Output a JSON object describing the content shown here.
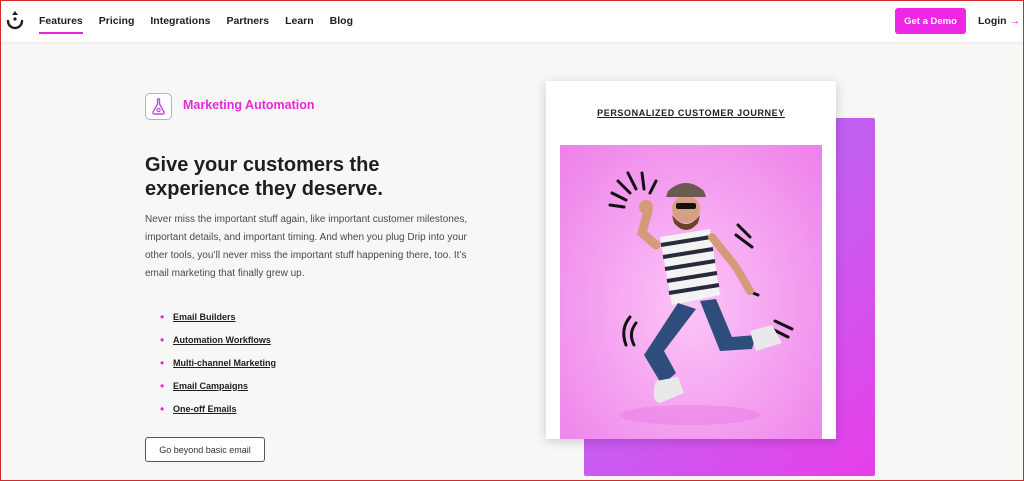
{
  "nav": {
    "items": [
      {
        "label": "Features",
        "active": true
      },
      {
        "label": "Pricing",
        "active": false
      },
      {
        "label": "Integrations",
        "active": false
      },
      {
        "label": "Partners",
        "active": false
      },
      {
        "label": "Learn",
        "active": false
      },
      {
        "label": "Blog",
        "active": false
      }
    ],
    "demo_label": "Get a Demo",
    "login_label": "Login",
    "login_arrow": "→"
  },
  "hero": {
    "badge_label": "Marketing Automation",
    "headline": "Give your customers the experience they deserve.",
    "description": "Never miss the important stuff again, like important customer milestones, important details, and important timing. And when you plug Drip into your other tools, you’ll never miss the important stuff happening there, too. It’s email marketing that finally grew up.",
    "features": [
      "Email Builders",
      "Automation Workflows",
      "Multi-channel Marketing",
      "Email Campaigns",
      "One-off Emails"
    ],
    "button_label": "Go beyond basic email"
  },
  "visual": {
    "card_title": "PERSONALIZED CUSTOMER JOURNEY"
  },
  "colors": {
    "accent": "#ee26e6",
    "text": "#1e1e1e",
    "background": "#f7f7f6"
  }
}
